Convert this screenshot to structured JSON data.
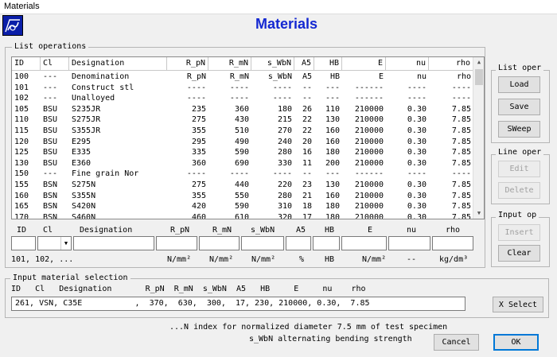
{
  "window": {
    "title": "Materials"
  },
  "app": {
    "title": "Materials"
  },
  "list_group": {
    "label": "List operations"
  },
  "table": {
    "headers": [
      "ID",
      "Cl",
      "Designation",
      "R_pN",
      "R_mN",
      "s_WbN",
      "A5",
      "HB",
      "E",
      "nu",
      "rho"
    ],
    "rows": [
      [
        "100",
        "---",
        "Denomination",
        "R_pN",
        "R_mN",
        "s_WbN",
        "A5",
        "HB",
        "E",
        "nu",
        "rho"
      ],
      [
        "101",
        "---",
        "Construct stl",
        "----",
        "----",
        "----",
        "--",
        "---",
        "------",
        "----",
        "----"
      ],
      [
        "102",
        "---",
        "Unalloyed",
        "----",
        "----",
        "----",
        "--",
        "---",
        "------",
        "----",
        "----"
      ],
      [
        "105",
        "BSU",
        "S235JR",
        "235",
        "360",
        "180",
        "26",
        "110",
        "210000",
        "0.30",
        "7.85"
      ],
      [
        "110",
        "BSU",
        "S275JR",
        "275",
        "430",
        "215",
        "22",
        "130",
        "210000",
        "0.30",
        "7.85"
      ],
      [
        "115",
        "BSU",
        "S355JR",
        "355",
        "510",
        "270",
        "22",
        "160",
        "210000",
        "0.30",
        "7.85"
      ],
      [
        "120",
        "BSU",
        "E295",
        "295",
        "490",
        "240",
        "20",
        "160",
        "210000",
        "0.30",
        "7.85"
      ],
      [
        "125",
        "BSU",
        "E335",
        "335",
        "590",
        "280",
        "16",
        "180",
        "210000",
        "0.30",
        "7.85"
      ],
      [
        "130",
        "BSU",
        "E360",
        "360",
        "690",
        "330",
        "11",
        "200",
        "210000",
        "0.30",
        "7.85"
      ],
      [
        "150",
        "---",
        "Fine grain Nor",
        "----",
        "----",
        "----",
        "--",
        "---",
        "------",
        "----",
        "----"
      ],
      [
        "155",
        "BSN",
        "S275N",
        "275",
        "440",
        "220",
        "23",
        "130",
        "210000",
        "0.30",
        "7.85"
      ],
      [
        "160",
        "BSN",
        "S355N",
        "355",
        "550",
        "280",
        "21",
        "160",
        "210000",
        "0.30",
        "7.85"
      ],
      [
        "165",
        "BSN",
        "S420N",
        "420",
        "590",
        "310",
        "18",
        "180",
        "210000",
        "0.30",
        "7.85"
      ],
      [
        "170",
        "BSN",
        "S460N",
        "460",
        "610",
        "320",
        "17",
        "180",
        "210000",
        "0.30",
        "7.85"
      ]
    ]
  },
  "input_row": {
    "labels": [
      "ID",
      "Cl",
      "Designation",
      "R_pN",
      "R_mN",
      "s_WbN",
      "A5",
      "HB",
      "E",
      "nu",
      "rho"
    ],
    "units": [
      "101, 102, ...",
      "N/mm²",
      "N/mm²",
      "N/mm²",
      "%",
      "HB",
      "N/mm²",
      "--",
      "kg/dm³"
    ]
  },
  "list_oper": {
    "label": "List oper",
    "load": "Load",
    "save": "Save",
    "sweep": "SWeep"
  },
  "line_oper": {
    "label": "Line oper",
    "edit": "Edit",
    "delete": "Delete"
  },
  "input_op": {
    "label": "Input op",
    "insert": "Insert",
    "clear": "Clear"
  },
  "selection": {
    "label": "Input material selection",
    "header": "ID   Cl   Designation       R_pN  R_mN  s_WbN  A5   HB     E     nu    rho",
    "value": "261, VSN, C35E           ,  370,  630,  300,  17, 230, 210000, 0.30,  7.85",
    "select_button": "X Select"
  },
  "notes": {
    "line1": "...N index for normalized diameter 7.5 mm of test specimen",
    "line2": "s_WbN alternating bending strength"
  },
  "footer": {
    "cancel": "Cancel",
    "ok": "OK"
  },
  "colors": {
    "title_blue": "#1428d2",
    "logo_bg": "#0a1ea8",
    "focus_border": "#0078d7"
  }
}
